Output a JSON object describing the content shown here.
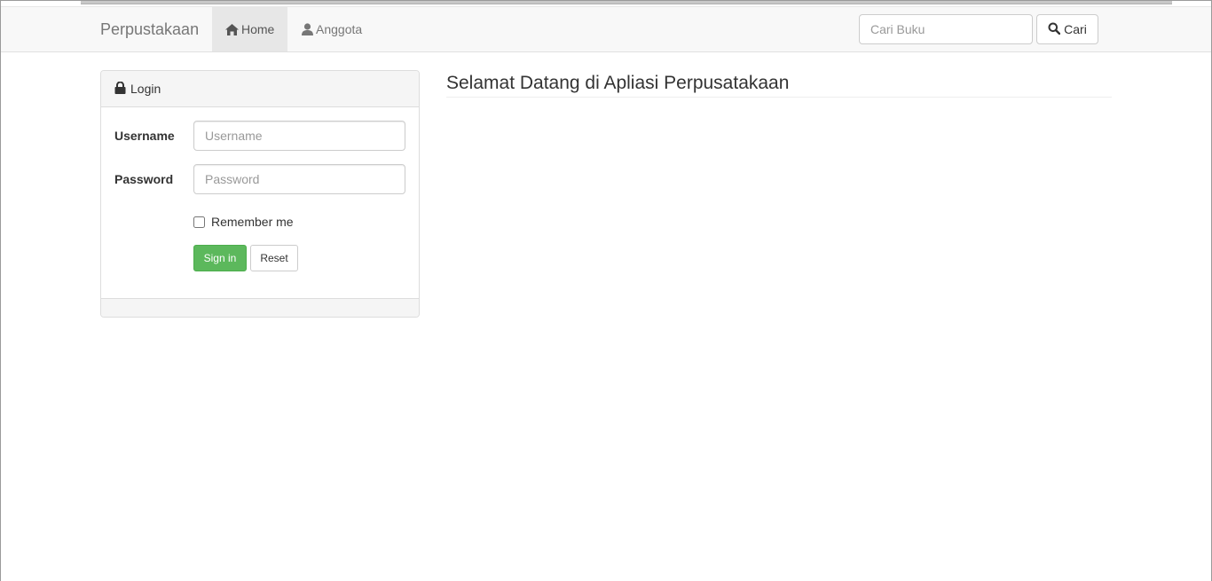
{
  "navbar": {
    "brand": "Perpustakaan",
    "items": [
      {
        "label": "Home",
        "icon": "home-icon",
        "active": true
      },
      {
        "label": "Anggota",
        "icon": "user-icon",
        "active": false
      }
    ],
    "search": {
      "placeholder": "Cari Buku",
      "value": "",
      "button_label": "Cari",
      "button_icon": "search-icon"
    }
  },
  "login_panel": {
    "title": "Login",
    "title_icon": "lock-icon",
    "username_label": "Username",
    "username_placeholder": "Username",
    "password_label": "Password",
    "password_placeholder": "Password",
    "remember_label": "Remember me",
    "remember_checked": false,
    "signin_label": "Sign in",
    "reset_label": "Reset"
  },
  "main": {
    "heading": "Selamat Datang di Apliasi Perpusatakaan"
  },
  "colors": {
    "navbar_bg": "#f8f8f8",
    "active_nav_bg": "#e7e7e7",
    "success": "#5cb85c",
    "panel_heading_bg": "#f5f5f5"
  }
}
